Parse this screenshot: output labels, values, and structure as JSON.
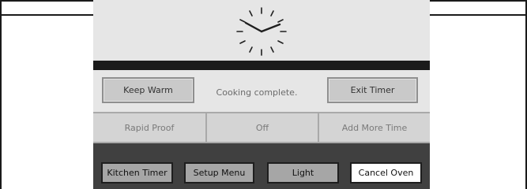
{
  "clock": {
    "icon": "clock-icon"
  },
  "status": {
    "keep_warm_label": "Keep Warm",
    "message": "Cooking complete.",
    "exit_timer_label": "Exit Timer"
  },
  "options": [
    {
      "label": "Rapid Proof"
    },
    {
      "label": "Off"
    },
    {
      "label": "Add More Time"
    }
  ],
  "bottom_bar": {
    "kitchen_timer_label": "Kitchen Timer",
    "setup_menu_label": "Setup Menu",
    "light_label": "Light",
    "cancel_oven_label": "Cancel Oven"
  },
  "colors": {
    "panel_dark": "#3c3c3c",
    "screen_light": "#e6e6e6",
    "button_gray": "#c9c9c9",
    "cancel_button": "#ffffff"
  }
}
